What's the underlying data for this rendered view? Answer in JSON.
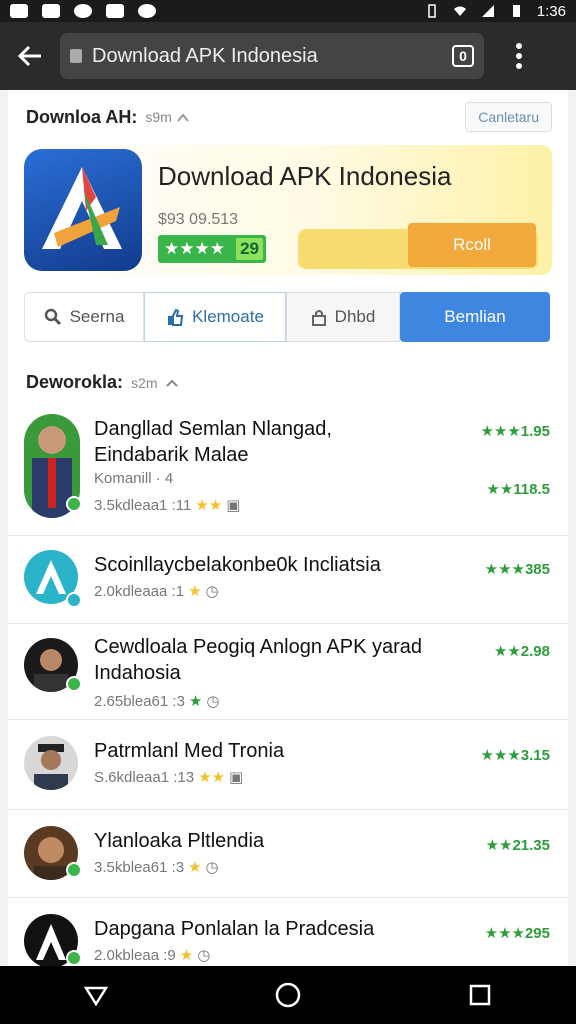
{
  "status_bar": {
    "time": "1:36"
  },
  "browser": {
    "url_title": "Download APK Indonesia",
    "tab_count": "0"
  },
  "page": {
    "title": "Downloa AH:",
    "title_sub": "s9m",
    "top_button": "Canletaru"
  },
  "hero": {
    "app_name": "Download APK Indonesia",
    "size": "$93 09.513",
    "rating_stars": "★★★★",
    "rating_count": "29",
    "install_label": "Rcoll"
  },
  "tabs": [
    {
      "label": "Seerna",
      "icon": "search-icon"
    },
    {
      "label": "Klemoate",
      "icon": "thumbs-up-icon"
    },
    {
      "label": "Dhbd",
      "icon": "lock-icon"
    },
    {
      "label": "Bemlian",
      "icon": ""
    }
  ],
  "section": {
    "title": "Deworokla:",
    "sub": "s2m"
  },
  "items": [
    {
      "title": "Dangllad Semlan Nlangad, Eindabarik Malae",
      "sub1": "Komanill  ·  4",
      "meta": "3.5kdleaa1 :11",
      "score_top": "★★★1.95",
      "score_bottom": "★★118.5"
    },
    {
      "title": "Scoinllaycbelakonbe0k Incliatsia",
      "meta": "2.0kdleaaa :1",
      "score_top": "★★★385"
    },
    {
      "title": "Cewdloala Peogiq Anlogn APK  yarad Indahosia",
      "meta": "2.65blea61 :3",
      "score_top": "★★2.98"
    },
    {
      "title": "Patrmlanl Med Tronia",
      "meta": "S.6kdleaa1 :13",
      "score_top": "★★★3.15"
    },
    {
      "title": "Ylanloaka Pltlendia",
      "meta": "3.5kblea61 :3",
      "score_top": "★★21.35"
    },
    {
      "title": "Dapgana Ponlalan la Pradcesia",
      "meta": "2.0kbleaa :9",
      "score_top": "★★★295"
    }
  ],
  "colors": {
    "accent": "#3e86e0",
    "rating_green": "#39b54a",
    "install": "#f0a93a"
  }
}
